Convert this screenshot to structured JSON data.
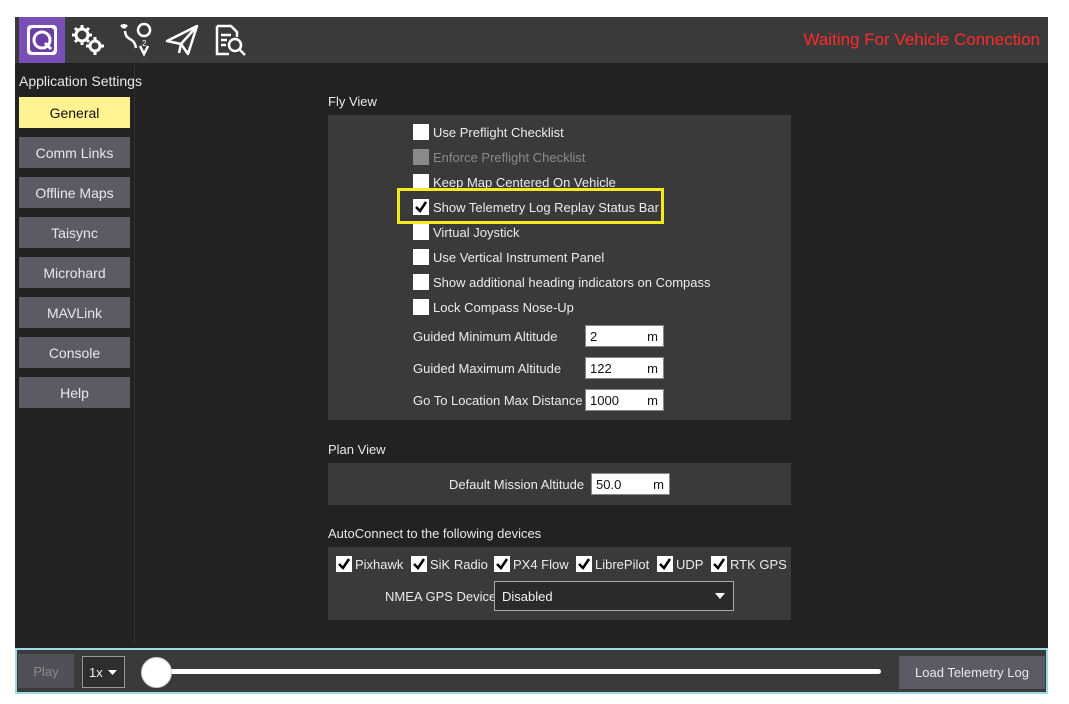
{
  "toolbar": {
    "icons": [
      "qgc-logo-icon",
      "settings-gears-icon",
      "plan-route-icon",
      "fly-paper-plane-icon",
      "analyze-document-icon"
    ],
    "status_text": "Waiting For Vehicle Connection",
    "status_color": "#ff2a2a"
  },
  "sidebar": {
    "title": "Application Settings",
    "items": [
      {
        "label": "General",
        "active": true
      },
      {
        "label": "Comm Links"
      },
      {
        "label": "Offline Maps"
      },
      {
        "label": "Taisync"
      },
      {
        "label": "Microhard"
      },
      {
        "label": "MAVLink"
      },
      {
        "label": "Console"
      },
      {
        "label": "Help"
      }
    ],
    "active_color": "#fff291"
  },
  "fly_view": {
    "title": "Fly View",
    "checkboxes": [
      {
        "label": "Use Preflight Checklist",
        "checked": false
      },
      {
        "label": "Enforce Preflight Checklist",
        "checked": false,
        "disabled": true
      },
      {
        "label": "Keep Map Centered On Vehicle",
        "checked": false
      },
      {
        "label": "Show Telemetry Log Replay Status Bar",
        "checked": true,
        "highlighted": true
      },
      {
        "label": "Virtual Joystick",
        "checked": false
      },
      {
        "label": "Use Vertical Instrument Panel",
        "checked": false
      },
      {
        "label": "Show additional heading indicators on Compass",
        "checked": false
      },
      {
        "label": "Lock Compass Nose-Up",
        "checked": false
      }
    ],
    "fields": [
      {
        "label": "Guided Minimum Altitude",
        "value": "2",
        "unit": "m"
      },
      {
        "label": "Guided Maximum Altitude",
        "value": "122",
        "unit": "m"
      },
      {
        "label": "Go To Location Max Distance",
        "value": "1000",
        "unit": "m"
      }
    ]
  },
  "plan_view": {
    "title": "Plan View",
    "field": {
      "label": "Default Mission Altitude",
      "value": "50.0",
      "unit": "m"
    }
  },
  "autoconnect": {
    "title": "AutoConnect to the following devices",
    "devices": [
      {
        "label": "Pixhawk",
        "checked": true
      },
      {
        "label": "SiK Radio",
        "checked": true
      },
      {
        "label": "PX4 Flow",
        "checked": true
      },
      {
        "label": "LibrePilot",
        "checked": true
      },
      {
        "label": "UDP",
        "checked": true
      },
      {
        "label": "RTK GPS",
        "checked": true
      }
    ],
    "nmea_label": "NMEA GPS Device",
    "nmea_value": "Disabled"
  },
  "replay_bar": {
    "play_label": "Play",
    "speed_value": "1x",
    "load_label": "Load Telemetry Log",
    "position_fraction": 0.0,
    "border_color": "#9edae6"
  },
  "highlight_color": "#f4ea1e"
}
